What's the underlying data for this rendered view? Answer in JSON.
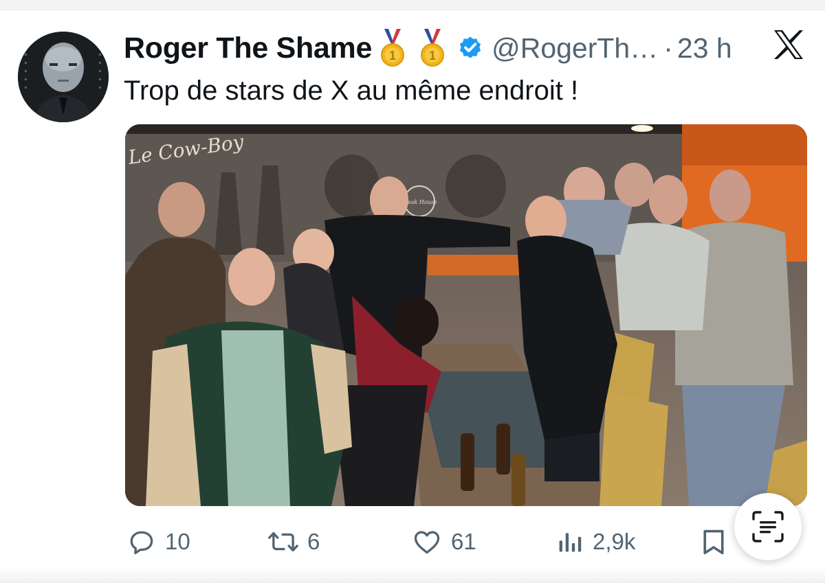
{
  "tweet": {
    "author_name": "Roger The Shame",
    "handle": "@RogerTh…",
    "separator": "·",
    "time": "23 h",
    "text": "Trop de stars de X au même endroit !",
    "badges": [
      "gold-medal-icon",
      "gold-medal-icon",
      "verified-badge-icon"
    ],
    "medal_digit": "1"
  },
  "photo": {
    "sign_text": "Le Cow-Boy",
    "logo_text": "Steak House"
  },
  "actions": {
    "replies": "10",
    "reposts": "6",
    "likes": "61",
    "views": "2,9k"
  },
  "colors": {
    "verified": "#1d9bf0",
    "text_secondary": "#536471",
    "medal_gold": "#f2b51d",
    "ribbon_blue": "#2f4ea1",
    "ribbon_red": "#d23a3a"
  }
}
